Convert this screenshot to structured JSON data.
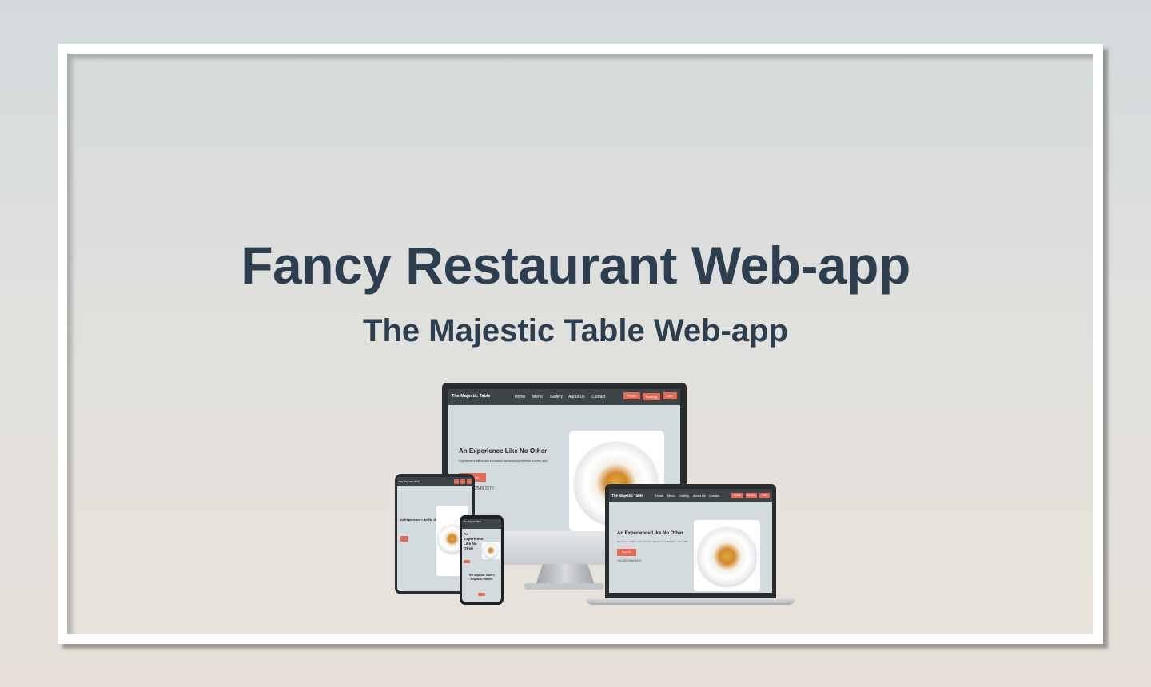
{
  "page": {
    "title": "Fancy Restaurant Web-app",
    "subtitle": "The Majestic Table Web-app"
  },
  "mockup": {
    "brand": "The Majestic Table",
    "nav_links": [
      "Home",
      "Menu",
      "Gallery",
      "About Us",
      "Contact"
    ],
    "actions": {
      "profile": "Profile",
      "booking": "Booking",
      "cart": "Cart"
    },
    "hero_heading": "An Experience Like No Other",
    "hero_text": "Experience tradition and innovation harmoniously blended in every dish.",
    "cta": "Book Us",
    "phone": "+44 020 2549 1570",
    "phone_partial": "2549 1570",
    "phone_section_heading": "The Majestic Table's Exquisite Flavors"
  },
  "colors": {
    "title": "#2c3e50",
    "nav": "#3d4549",
    "accent": "#e36a54",
    "screen_bg": "#d4dbde"
  }
}
